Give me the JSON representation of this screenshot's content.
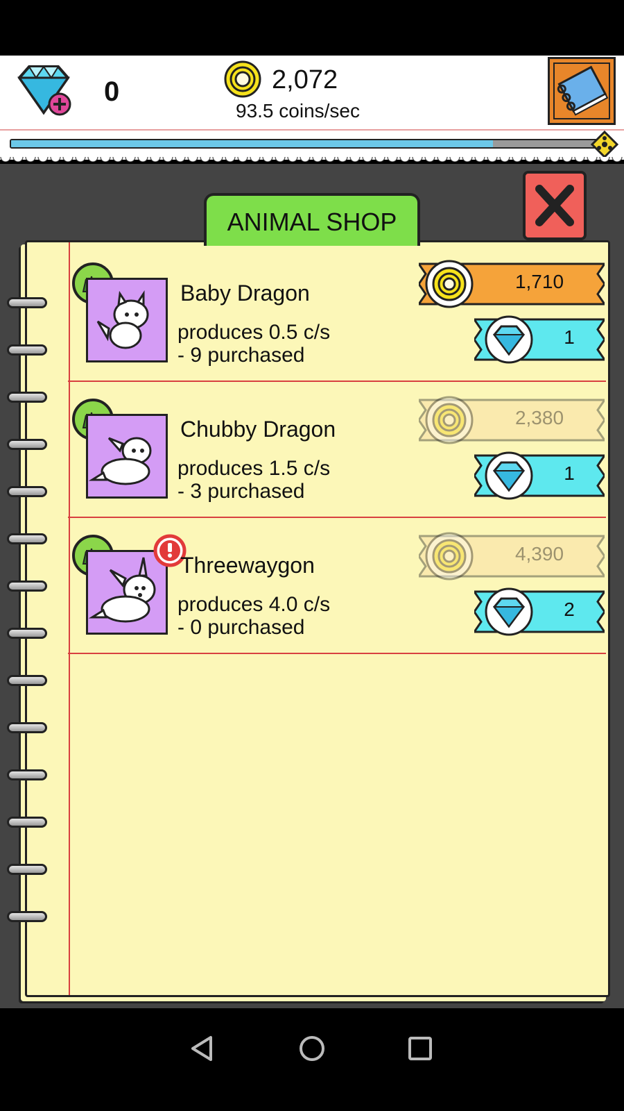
{
  "header": {
    "gem_count": "0",
    "coin_total": "2,072",
    "coin_rate": "93.5 coins/sec",
    "progress": 0.82
  },
  "shop": {
    "title": "ANIMAL SHOP",
    "items": [
      {
        "name": "Baby Dragon",
        "produces": "produces 0.5 c/s",
        "purchased": "- 9 purchased",
        "coin_price": "1,710",
        "gem_price": "1",
        "coin_affordable": true,
        "alert": false
      },
      {
        "name": "Chubby Dragon",
        "produces": "produces 1.5 c/s",
        "purchased": "- 3 purchased",
        "coin_price": "2,380",
        "gem_price": "1",
        "coin_affordable": false,
        "alert": false
      },
      {
        "name": "Threewaygon",
        "produces": "produces 4.0 c/s",
        "purchased": "- 0 purchased",
        "coin_price": "4,390",
        "gem_price": "2",
        "coin_affordable": false,
        "alert": true
      }
    ]
  },
  "colors": {
    "coin_bar": "#f5a33a",
    "coin_bar_disabled": "#f9d9a0",
    "gem_bar": "#5ee8ee",
    "paper": "#fcf7b8",
    "tab_green": "#7ede4a",
    "close_red": "#f0605a",
    "portrait_purple": "#d49cf5"
  },
  "icons": {
    "gem": "gem-plus-icon",
    "coin": "coin-icon",
    "book": "book-icon",
    "close": "close-x-icon",
    "grass": "grass-icon",
    "alert": "exclamation-icon",
    "nav_back": "back-triangle-icon",
    "nav_home": "home-circle-icon",
    "nav_recent": "recents-square-icon"
  }
}
